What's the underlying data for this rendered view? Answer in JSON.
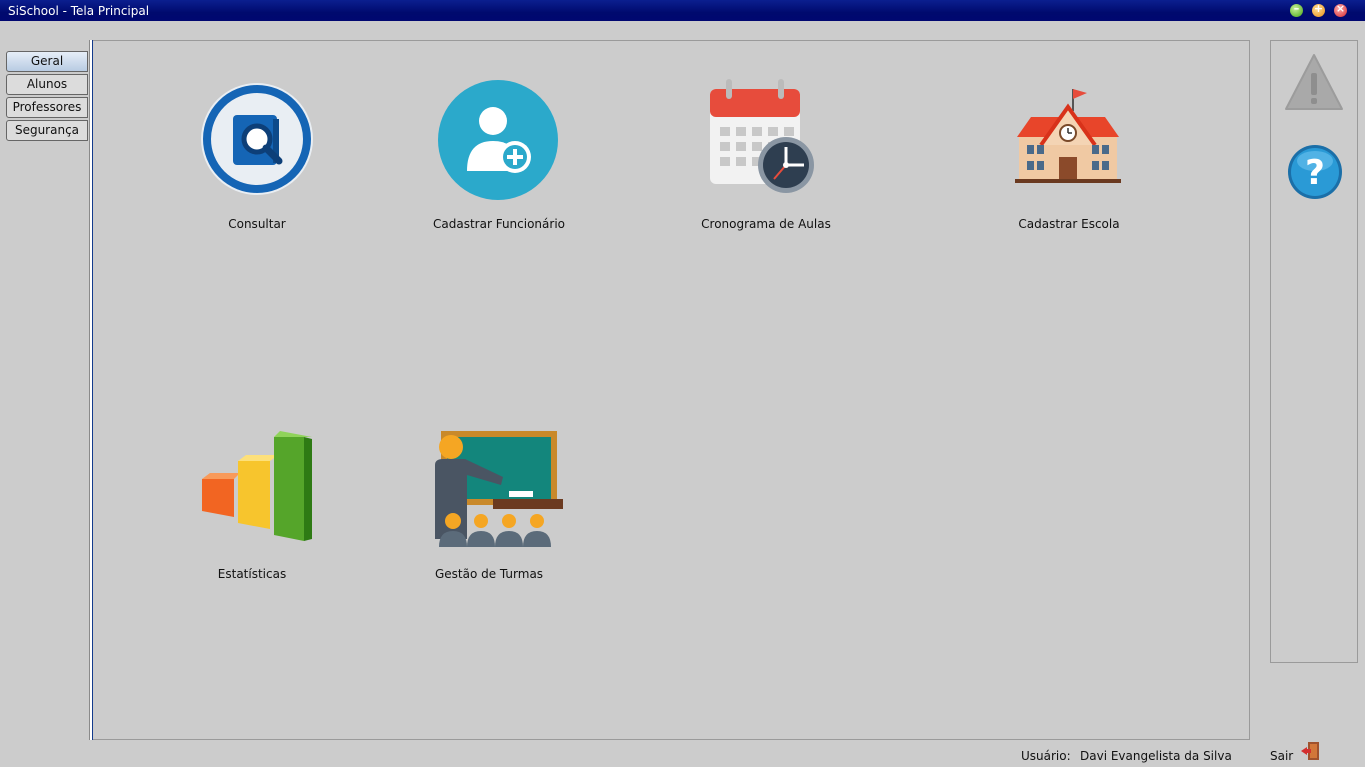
{
  "window": {
    "title": "SiSchool - Tela Principal"
  },
  "sidebar": {
    "tabs": [
      "Geral",
      "Alunos",
      "Professores",
      "Segurança"
    ]
  },
  "main": {
    "items": [
      {
        "label": "Consultar",
        "icon": "search-book-icon"
      },
      {
        "label": "Cadastrar Funcionário",
        "icon": "add-user-icon"
      },
      {
        "label": "Cronograma de Aulas",
        "icon": "calendar-clock-icon"
      },
      {
        "label": "Cadastrar Escola",
        "icon": "school-icon"
      },
      {
        "label": "Estatísticas",
        "icon": "bar-chart-icon"
      },
      {
        "label": "Gestão de Turmas",
        "icon": "teacher-classroom-icon"
      }
    ]
  },
  "rightpanel": {
    "icons": [
      "warning-icon",
      "help-icon"
    ]
  },
  "status": {
    "user_label": "Usuário:",
    "user_name": "Davi Evangelista da Silva",
    "exit_label": "Sair"
  }
}
